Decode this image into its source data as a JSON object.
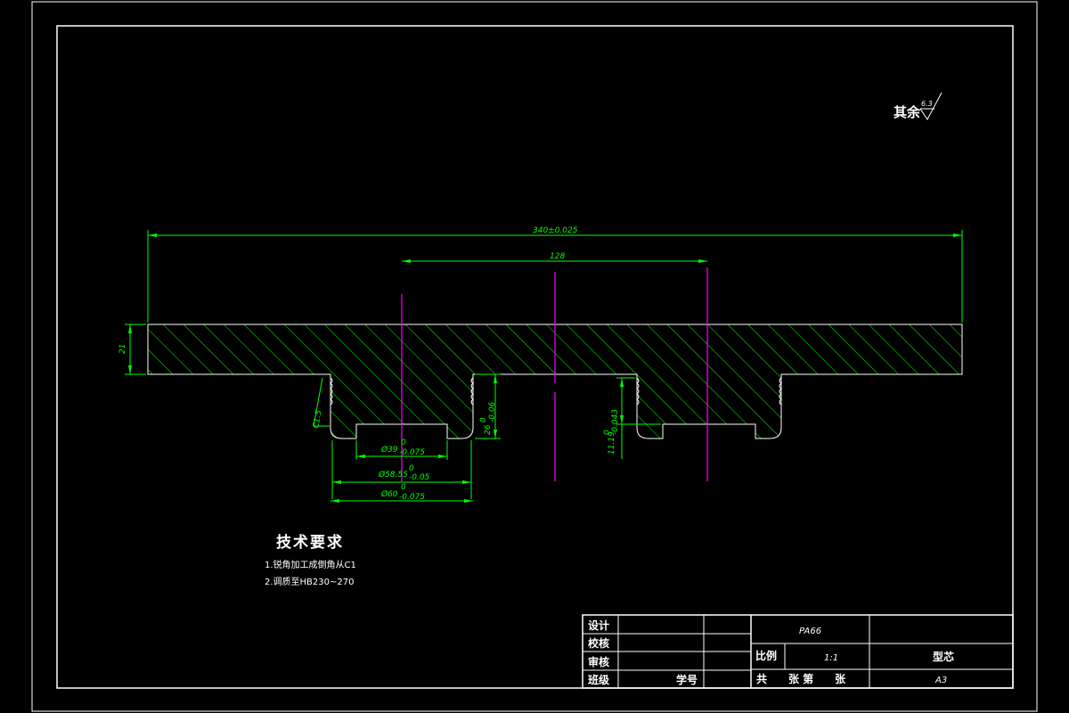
{
  "drawing": {
    "roughness_note": "其余",
    "roughness_value": "6.3",
    "dimensions": {
      "overall_length": "340±0.025",
      "center_distance": "128",
      "thickness": "21",
      "groove_depth": "26",
      "groove_depth_tol": "0",
      "groove_depth_tol2": "-0.06",
      "chamfer": "C1.5",
      "dia_39": "Ø39",
      "dia_39_tol_upper": "0",
      "dia_39_tol_lower": "-0.075",
      "dia_58": "Ø58.55",
      "dia_58_tol_upper": "0",
      "dia_58_tol_lower": "-0.05",
      "dia_60": "Ø60",
      "dia_60_tol_upper": "0",
      "dia_60_tol_lower": "-0.075",
      "height_1119": "11.19",
      "height_1119_tol_upper": "0",
      "height_1119_tol_lower": "-0.043"
    },
    "tech_requirements": {
      "title": "技术要求",
      "items": [
        "1.锐角加工成倒角从C1",
        "2.调质至HB230~270"
      ]
    }
  },
  "title_block": {
    "design": "设计",
    "check": "校核",
    "review": "审核",
    "class": "班级",
    "student_no": "学号",
    "material": "PA66",
    "scale_label": "比例",
    "scale_value": "1:1",
    "part_name": "型芯",
    "sheets": "共　　张 第　　张",
    "sheet_size": "A3"
  },
  "colors": {
    "background": "#000000",
    "frame": "#ffffff",
    "dimension": "#00ff00",
    "centerline": "#ff00ff",
    "hatch": "#00ff00"
  }
}
